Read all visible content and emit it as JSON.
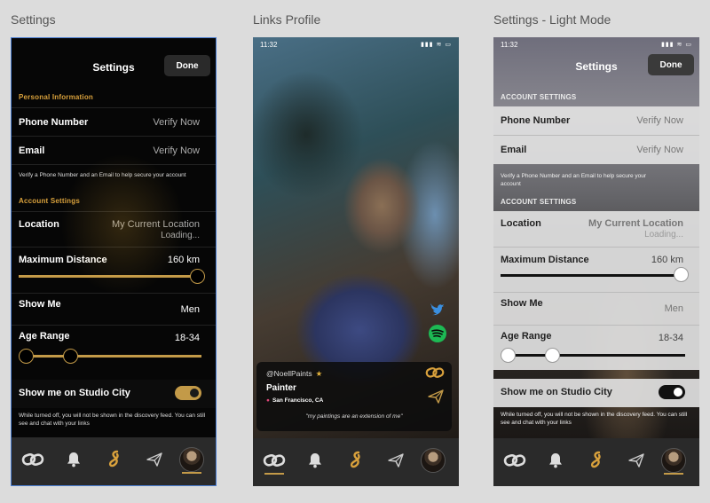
{
  "frames": {
    "settings": "Settings",
    "links_profile": "Links Profile",
    "settings_light": "Settings - Light Mode"
  },
  "settings": {
    "title": "Settings",
    "done": "Done",
    "personal_info": "Personal Information",
    "phone_label": "Phone Number",
    "phone_value": "Verify Now",
    "email_label": "Email",
    "email_value": "Verify Now",
    "verify_help": "Verify a Phone Number and an Email to help secure your account",
    "account_settings": "Account Settings",
    "location_label": "Location",
    "location_value": "My Current Location",
    "location_loading": "Loading...",
    "max_distance_label": "Maximum Distance",
    "max_distance_value": "160 km",
    "max_distance_level": 1.0,
    "show_me_label": "Show Me",
    "show_me_value": "Men",
    "age_range_label": "Age Range",
    "age_range_value": "18-34",
    "age_range_low": 18,
    "age_range_high": 34,
    "studio_city_label": "Show me on Studio City",
    "studio_city_on": true,
    "studio_city_help": "While turned off, you will not be shown in the discovery feed. You can still see and chat with your links"
  },
  "links_profile": {
    "time": "11:32",
    "status_icons": "▮▮▮ ≋ ▭",
    "handle": "@NoellPaints",
    "role": "Painter",
    "location": "San Francisco, CA",
    "quote": "\"my paintings are an extension of me\""
  },
  "settings_light": {
    "time": "11:32",
    "status_icons": "▮▮▮ ≋ ▭",
    "title": "Settings",
    "done": "Done",
    "account_settings_1": "ACCOUNT SETTINGS",
    "phone_label": "Phone Number",
    "phone_value": "Verify Now",
    "email_label": "Email",
    "email_value": "Verify Now",
    "verify_help": "Verify a Phone Number and an Email to help secure your account",
    "account_settings_2": "ACCOUNT SETTINGS",
    "location_label": "Location",
    "location_value": "My Current Location",
    "location_loading": "Loading...",
    "max_distance_label": "Maximum Distance",
    "max_distance_value": "160 km",
    "show_me_label": "Show Me",
    "show_me_value": "Men",
    "age_range_label": "Age Range",
    "age_range_value": "18-34",
    "studio_city_label": "Show me on Studio City",
    "studio_city_on": true,
    "studio_city_help": "While turned off, you will not be shown in the discovery feed. You can still see and chat with your links"
  },
  "tabbar": {
    "tabs": [
      "links-icon",
      "bell-icon",
      "studio-city-icon",
      "send-icon",
      "avatar"
    ]
  },
  "colors": {
    "accent": "#c39a48",
    "selection_border": "#4c7fd3",
    "dark_bg": "#060606",
    "tabbar_bg": "#2a2a2a",
    "pin": "#e0477a",
    "star": "#e3b23c"
  }
}
